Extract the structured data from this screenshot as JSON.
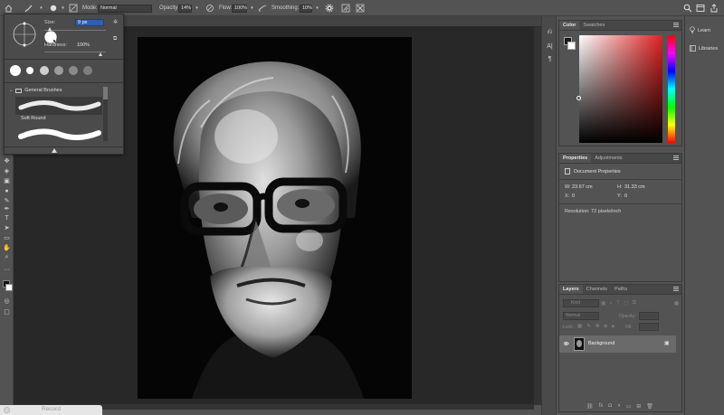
{
  "options": {
    "mode_label": "Mode:",
    "mode_value": "Normal",
    "opacity_label": "Opacity:",
    "opacity_value": "14%",
    "flow_label": "Flow:",
    "flow_value": "100%",
    "smoothing_label": "Smoothing:",
    "smoothing_value": "10%"
  },
  "brush_popup": {
    "size_label": "Size:",
    "size_value": "9 px",
    "hardness_label": "Hardness:",
    "hardness_value": "100%",
    "group_label": "General Brushes",
    "brush_name": "Soft Round"
  },
  "color_panel": {
    "tabs": [
      "Color",
      "Swatches"
    ],
    "accent": "#e02020"
  },
  "properties_panel": {
    "tabs": [
      "Properties",
      "Adjustments"
    ],
    "doc_label": "Document Properties",
    "w_label": "W:",
    "w_value": "23.67 cm",
    "h_label": "H:",
    "h_value": "31.33 cm",
    "x_label": "X:",
    "x_value": "0",
    "y_label": "Y:",
    "y_value": "0",
    "resolution_label": "Resolution: 72 pixels/inch"
  },
  "layers_panel": {
    "tabs": [
      "Layers",
      "Channels",
      "Paths"
    ],
    "filter_kind": "Kind",
    "blend_mode": "Normal",
    "opacity_label": "Opacity:",
    "lock_label": "Lock:",
    "fill_label": "Fill:",
    "layer_name": "Background"
  },
  "learn_panel": {
    "learn_label": "Learn",
    "libraries_label": "Libraries"
  },
  "record_bar": {
    "label": "Record"
  }
}
